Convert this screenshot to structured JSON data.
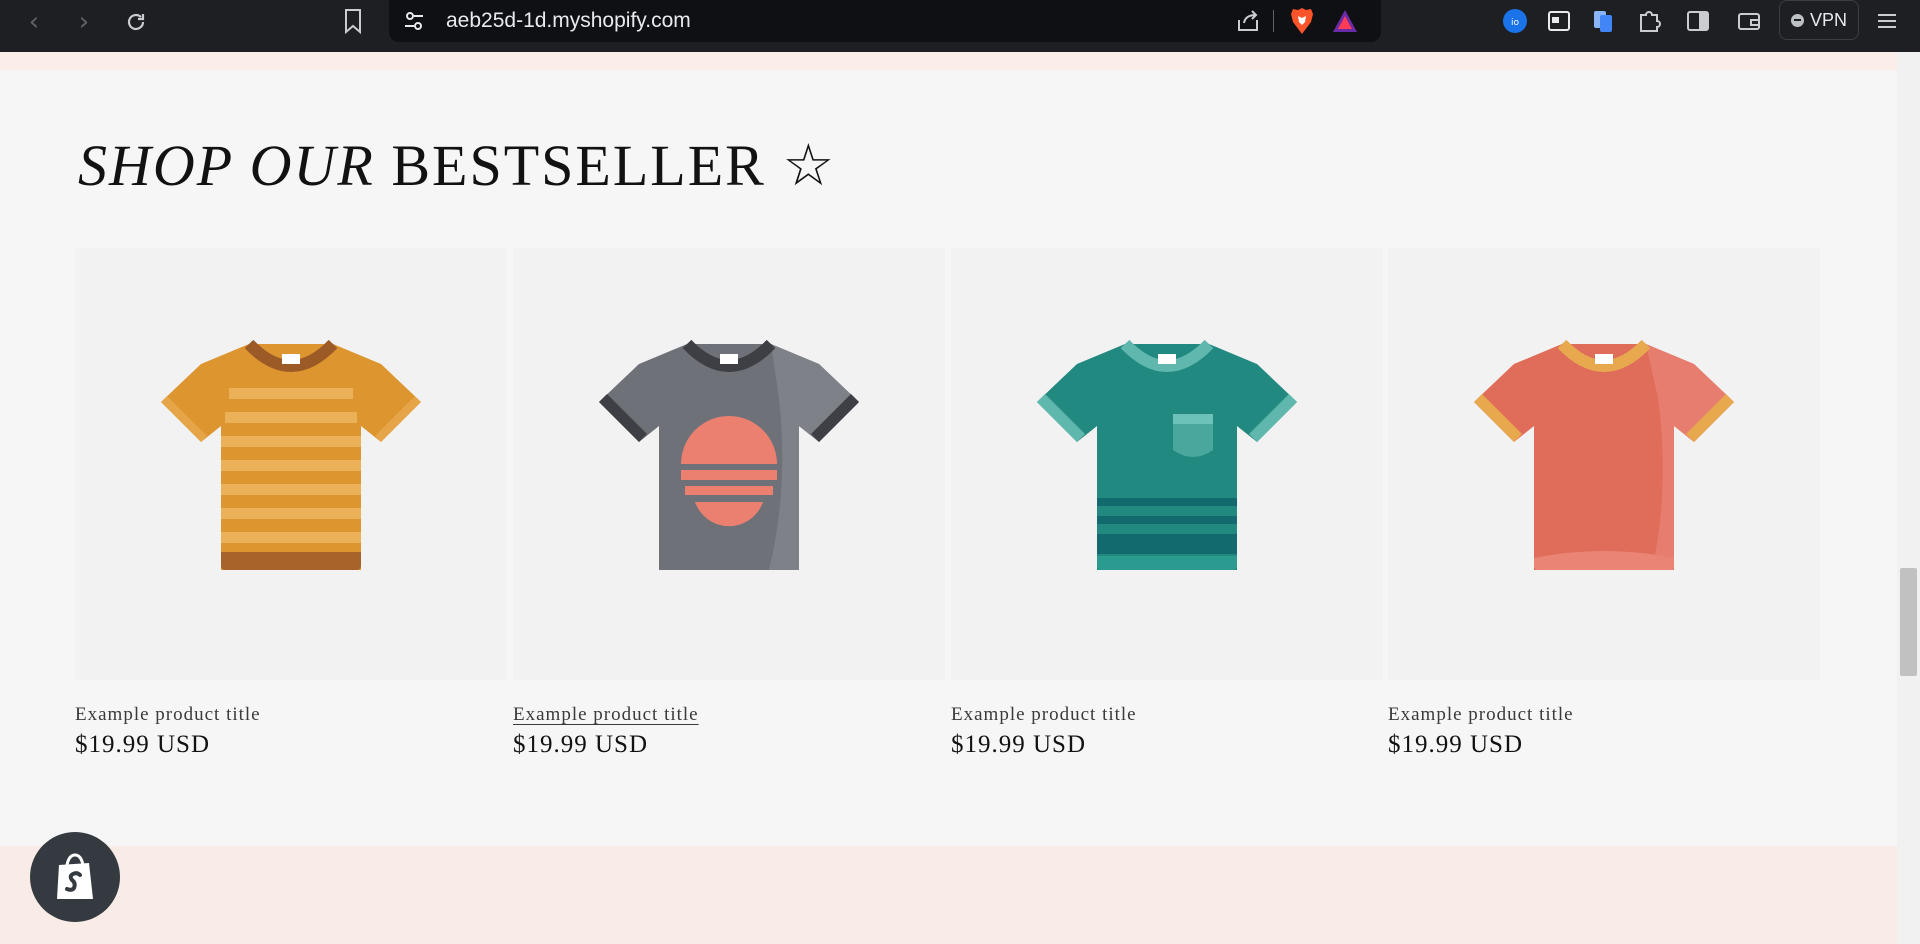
{
  "browser": {
    "url": "aeb25d-1d.myshopify.com",
    "vpn_label": "VPN",
    "icons": [
      "back-icon",
      "forward-icon",
      "reload-icon",
      "bookmark-icon",
      "site-settings-icon",
      "share-icon",
      "brave-shields-icon",
      "brave-rewards-icon",
      "extension-icon",
      "tab-manager-icon",
      "files-icon",
      "extensions-icon",
      "sidebar-icon",
      "wallet-icon",
      "menu-icon"
    ]
  },
  "section": {
    "heading_italic": "SHOP OUR",
    "heading_rest": " BESTSELLER ☆"
  },
  "products": [
    {
      "title": "Example product title",
      "price": "$19.99 USD",
      "shirt": "orange-striped",
      "hovered": false
    },
    {
      "title": "Example product title",
      "price": "$19.99 USD",
      "shirt": "gray-sunset",
      "hovered": true
    },
    {
      "title": "Example product title",
      "price": "$19.99 USD",
      "shirt": "teal-pocket",
      "hovered": false
    },
    {
      "title": "Example product title",
      "price": "$19.99 USD",
      "shirt": "coral-plain",
      "hovered": false
    }
  ],
  "colors": {
    "page_bg": "#f6f6f6",
    "band_peach": "#fbeee8",
    "card_bg": "#f2f2f2",
    "text": "#121212",
    "shopify_badge": "#343a40"
  }
}
